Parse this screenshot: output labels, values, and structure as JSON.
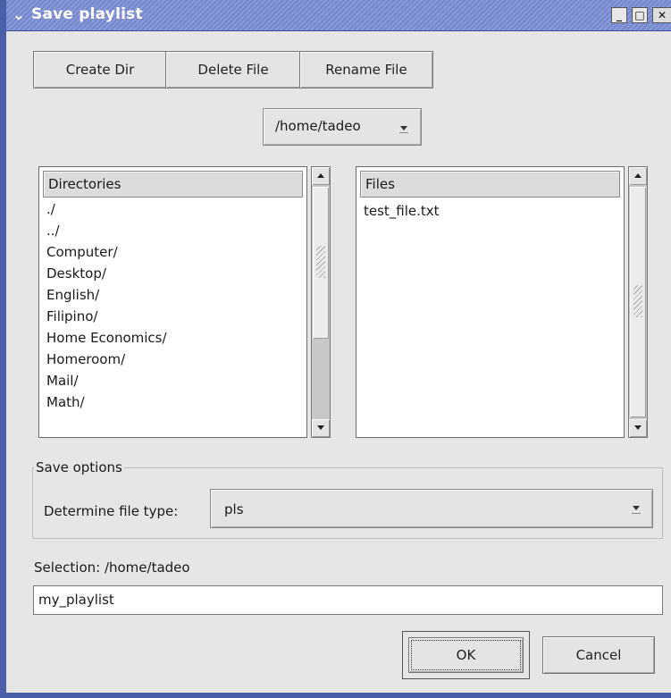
{
  "window": {
    "title": "Save playlist",
    "menu_glyph": "⌄",
    "minimize_glyph": "_",
    "maximize_glyph": "□",
    "close_glyph": "✕"
  },
  "toolbar": {
    "create_dir": "Create Dir",
    "delete_file": "Delete File",
    "rename_file": "Rename File"
  },
  "path_combo": {
    "value": "/home/tadeo"
  },
  "directories": {
    "header": "Directories",
    "items": [
      "./",
      "../",
      "Computer/",
      "Desktop/",
      "English/",
      "Filipino/",
      "Home Economics/",
      "Homeroom/",
      "Mail/",
      "Math/"
    ]
  },
  "files": {
    "header": "Files",
    "items": [
      "test_file.txt"
    ]
  },
  "save_options": {
    "legend": "Save options",
    "file_type_label": "Determine file type:",
    "file_type_value": "pls"
  },
  "selection": {
    "label": "Selection: /home/tadeo",
    "value": "my_playlist"
  },
  "buttons": {
    "ok": "OK",
    "cancel": "Cancel"
  },
  "colors": {
    "titlebar": "#7486cc",
    "frame": "#4a5fa8",
    "background": "#e6e6e6"
  }
}
